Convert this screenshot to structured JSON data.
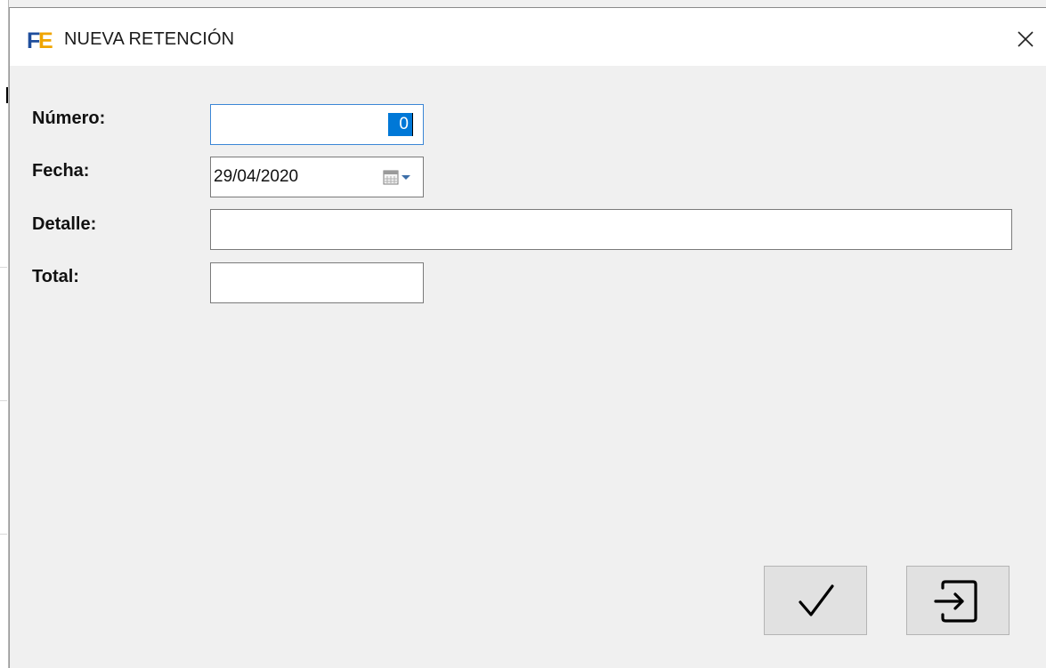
{
  "window": {
    "title": "NUEVA RETENCIÓN",
    "logo_text": "FE"
  },
  "colors": {
    "accent_blue": "#0078d7",
    "logo_blue": "#1f4e9c",
    "logo_orange": "#f0a500"
  },
  "form": {
    "numero": {
      "label": "Número:",
      "value": "0"
    },
    "fecha": {
      "label": "Fecha:",
      "value": "29/04/2020"
    },
    "detalle": {
      "label": "Detalle:",
      "value": ""
    },
    "total": {
      "label": "Total:",
      "value": ""
    }
  },
  "buttons": {
    "confirm_icon": "check-icon",
    "exit_icon": "exit-icon",
    "calendar_icon": "calendar-dropdown-icon",
    "close_icon": "close-icon"
  }
}
